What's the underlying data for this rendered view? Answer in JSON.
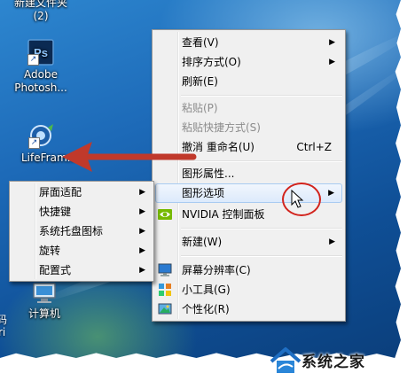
{
  "desktop": {
    "top_label": "新建文件夹",
    "top_label_count": "(2)",
    "icons": [
      {
        "label": "Adobe Photosh...",
        "line1": "Adobe",
        "line2": "Photosh...",
        "icon": "photoshop-icon"
      },
      {
        "label": "LifeFram...",
        "line1": "LifeFram...",
        "icon": "lifeframe-shortcut-icon"
      },
      {
        "label": "计算机",
        "line1": "计算机",
        "icon": "computer-icon"
      }
    ],
    "edge_chars": [
      "码",
      "ri"
    ]
  },
  "context_menu": {
    "items": [
      {
        "label": "查看(V)",
        "submenu": true
      },
      {
        "label": "排序方式(O)",
        "submenu": true
      },
      {
        "label": "刷新(E)"
      },
      {
        "separator": true
      },
      {
        "label": "粘贴(P)",
        "disabled": true
      },
      {
        "label": "粘贴快捷方式(S)",
        "disabled": true
      },
      {
        "label": "撤消 重命名(U)",
        "shortcut": "Ctrl+Z"
      },
      {
        "separator": true
      },
      {
        "label": "图形属性..."
      },
      {
        "label": "图形选项",
        "submenu": true,
        "highlighted": true
      },
      {
        "label": "NVIDIA 控制面板",
        "icon": "nvidia-icon"
      },
      {
        "separator": true
      },
      {
        "label": "新建(W)",
        "submenu": true
      },
      {
        "separator": true
      },
      {
        "label": "屏幕分辨率(C)",
        "icon": "display-icon"
      },
      {
        "label": "小工具(G)",
        "icon": "gadgets-icon"
      },
      {
        "label": "个性化(R)",
        "icon": "personalize-icon"
      }
    ],
    "submenu_arrow": "▶"
  },
  "graphics_submenu": {
    "items": [
      {
        "label": "屏面适配"
      },
      {
        "label": "快捷键"
      },
      {
        "label": "系统托盘图标"
      },
      {
        "label": "旋转"
      },
      {
        "label": "配置式"
      }
    ]
  },
  "watermark": {
    "text": "系统之家",
    "icon": "house-logo-icon"
  },
  "colors": {
    "annotation_red": "#d2231c",
    "highlight_border": "#a8cbf1",
    "menu_bg": "#f0f0f0"
  }
}
